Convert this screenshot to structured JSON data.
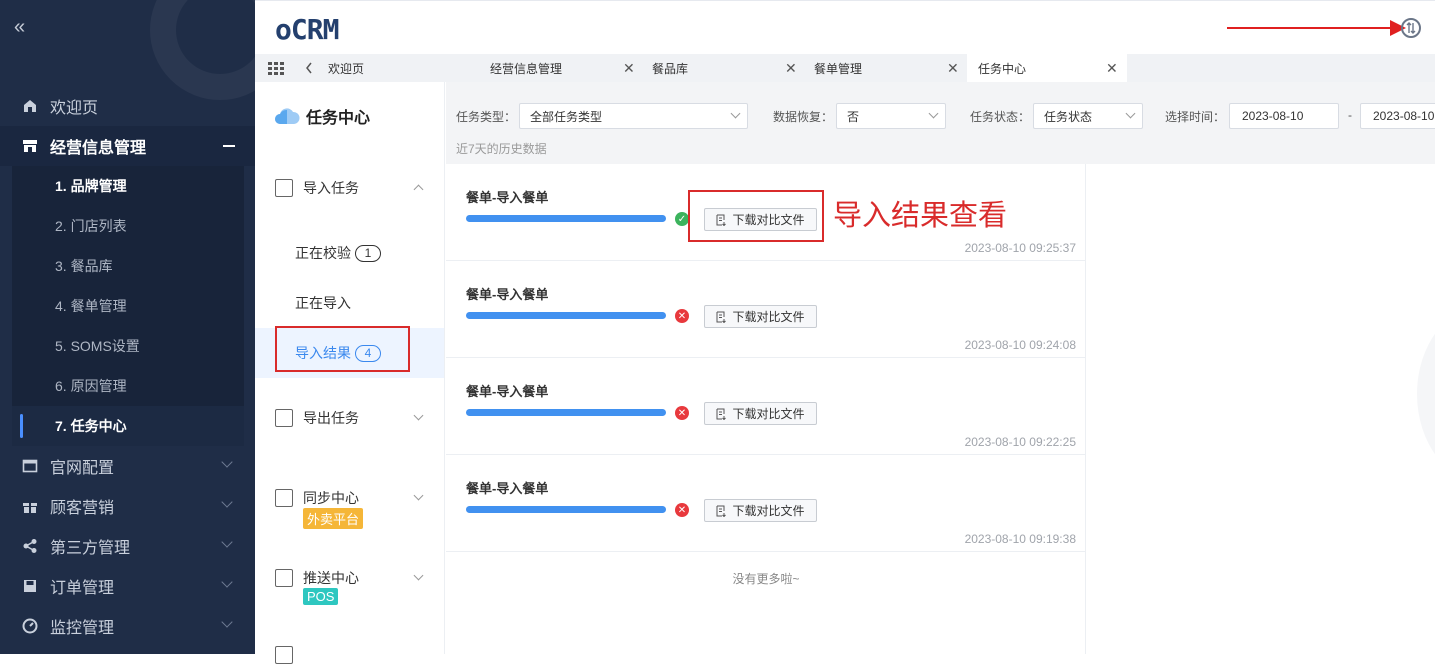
{
  "sidebar": {
    "collapse_icon": "«",
    "items": [
      {
        "label": "欢迎页",
        "icon": "home-icon"
      },
      {
        "label": "经营信息管理",
        "icon": "store-icon"
      },
      {
        "label": "官网配置",
        "icon": "window-icon"
      },
      {
        "label": "顾客营销",
        "icon": "gift-icon"
      },
      {
        "label": "第三方管理",
        "icon": "share-icon"
      },
      {
        "label": "订单管理",
        "icon": "save-icon"
      },
      {
        "label": "监控管理",
        "icon": "gauge-icon"
      }
    ],
    "submenu": [
      "1. 品牌管理",
      "2. 门店列表",
      "3. 餐品库",
      "4. 餐单管理",
      "5. SOMS设置",
      "6. 原因管理",
      "7. 任务中心"
    ]
  },
  "header": {
    "logo": "oCRM"
  },
  "tabs": [
    {
      "label": "欢迎页"
    },
    {
      "label": "经营信息管理"
    },
    {
      "label": "餐品库"
    },
    {
      "label": "餐单管理"
    },
    {
      "label": "任务中心"
    }
  ],
  "tasknav": {
    "title": "任务中心",
    "import": {
      "label": "导入任务",
      "subs": [
        {
          "label": "正在校验",
          "badge": "1"
        },
        {
          "label": "正在导入",
          "badge": ""
        },
        {
          "label": "导入结果",
          "badge": "4"
        }
      ]
    },
    "export_label": "导出任务",
    "sync_label": "同步中心",
    "sync_tag": "外卖平台",
    "push_label": "推送中心",
    "push_tag": "POS"
  },
  "filters": {
    "type_label": "任务类型：",
    "type_value": "全部任务类型",
    "restore_label": "数据恢复：",
    "restore_value": "否",
    "status_label": "任务状态：",
    "status_value": "任务状态",
    "time_label": "选择时间：",
    "date_from": "2023-08-10",
    "date_sep": "-",
    "date_to": "2023-08-10",
    "history_note": "近7天的历史数据"
  },
  "tasks": [
    {
      "title": "餐单-导入餐单",
      "status": "success",
      "button": "下载对比文件",
      "time": "2023-08-10 09:25:37"
    },
    {
      "title": "餐单-导入餐单",
      "status": "error",
      "button": "下载对比文件",
      "time": "2023-08-10 09:24:08"
    },
    {
      "title": "餐单-导入餐单",
      "status": "error",
      "button": "下载对比文件",
      "time": "2023-08-10 09:22:25"
    },
    {
      "title": "餐单-导入餐单",
      "status": "error",
      "button": "下载对比文件",
      "time": "2023-08-10 09:19:38"
    }
  ],
  "no_more": "没有更多啦~",
  "annotation": "导入结果查看",
  "colors": {
    "sidebar_bg": "#1f2d47",
    "accent": "#3a88ee",
    "success": "#3cb35d",
    "error": "#e8393d",
    "annotation": "#d92b2b",
    "tag_orange": "#f5b638",
    "tag_teal": "#2ec7c0"
  }
}
